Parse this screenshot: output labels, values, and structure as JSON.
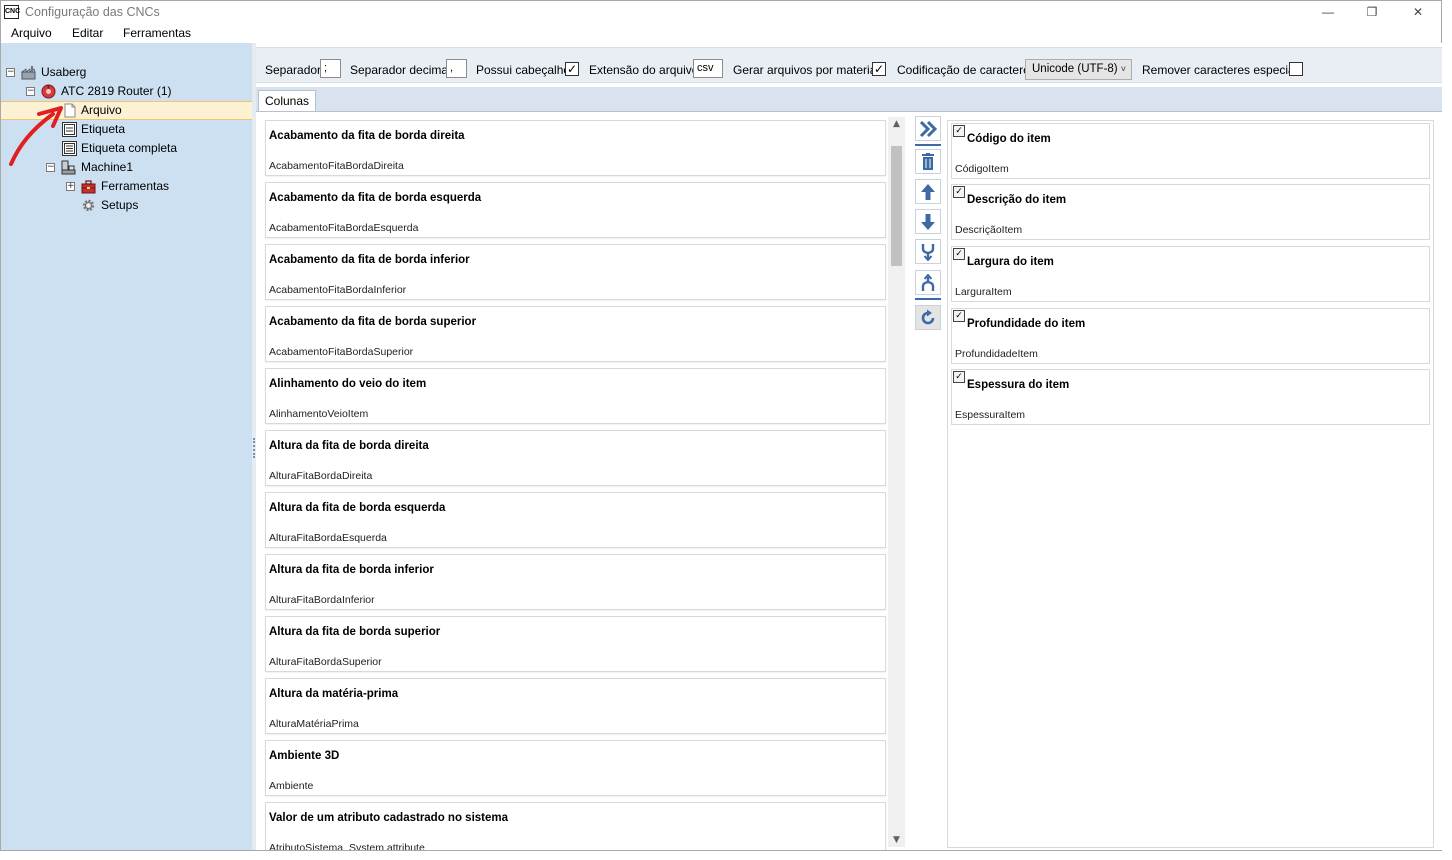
{
  "window": {
    "title": "Configuração das CNCs",
    "app_icon_text": "CNC",
    "controls": {
      "minimize": "—",
      "maximize": "❐",
      "close": "✕"
    }
  },
  "menu": [
    "Arquivo",
    "Editar",
    "Ferramentas"
  ],
  "tree": {
    "root": "Usaberg",
    "machine": "ATC 2819 Router (1)",
    "selected": "Arquivo",
    "etiqueta": "Etiqueta",
    "etiqueta_completa": "Etiqueta completa",
    "machine1": "Machine1",
    "ferramentas": "Ferramentas",
    "setups": "Setups",
    "expander_minus": "−",
    "expander_plus": "+"
  },
  "toolbar": {
    "separador_label": "Separador",
    "separador_value": ";",
    "separador_decimal_label": "Separador decimal",
    "separador_decimal_value": ",",
    "possui_cabecalho_label": "Possui cabeçalho",
    "possui_cabecalho_checked": "✓",
    "extensao_label": "Extensão do arquivo",
    "extensao_value": "csv",
    "gerar_label": "Gerar arquivos por material",
    "gerar_checked": "✓",
    "codificacao_label": "Codificação de caracteres",
    "codificacao_value": "Unicode (UTF-8)",
    "codificacao_arrow": "˅",
    "remover_label": "Remover caracteres especiais",
    "remover_checked": ""
  },
  "tab": {
    "label": "Colunas"
  },
  "available_columns": [
    {
      "title": "Acabamento da fita de borda direita",
      "key": "AcabamentoFitaBordaDireita"
    },
    {
      "title": "Acabamento da fita de borda esquerda",
      "key": "AcabamentoFitaBordaEsquerda"
    },
    {
      "title": "Acabamento da fita de borda inferior",
      "key": "AcabamentoFitaBordaInferior"
    },
    {
      "title": "Acabamento da fita de borda superior",
      "key": "AcabamentoFitaBordaSuperior"
    },
    {
      "title": "Alinhamento do veio do item",
      "key": "AlinhamentoVeioItem"
    },
    {
      "title": "Altura da fita de borda direita",
      "key": "AlturaFitaBordaDireita"
    },
    {
      "title": "Altura da fita de borda esquerda",
      "key": "AlturaFitaBordaEsquerda"
    },
    {
      "title": "Altura da fita de borda inferior",
      "key": "AlturaFitaBordaInferior"
    },
    {
      "title": "Altura da fita de borda superior",
      "key": "AlturaFitaBordaSuperior"
    },
    {
      "title": "Altura da matéria-prima",
      "key": "AlturaMatériaPrima"
    },
    {
      "title": "Ambiente 3D",
      "key": "Ambiente"
    },
    {
      "title": "Valor de um atributo cadastrado no sistema",
      "key": "AtributoSistema_System attribute"
    }
  ],
  "selected_columns": [
    {
      "title": "Código do item",
      "key": "CódigoItem",
      "check": "✓"
    },
    {
      "title": "Descrição do item",
      "key": "DescriçãoItem",
      "check": "✓"
    },
    {
      "title": "Largura do item",
      "key": "LarguraItem",
      "check": "✓"
    },
    {
      "title": "Profundidade do item",
      "key": "ProfundidadeItem",
      "check": "✓"
    },
    {
      "title": "Espessura do item",
      "key": "EspessuraItem",
      "check": "✓"
    }
  ],
  "scrollbar": {
    "up": "▲",
    "down": "▼"
  },
  "colors": {
    "sidebar_bg": "#cde0f2",
    "selection_bg": "#fdf1d4",
    "selection_border": "#f2c46c",
    "action_icon": "#3d6aa2",
    "annotation_arrow": "#e02020"
  }
}
